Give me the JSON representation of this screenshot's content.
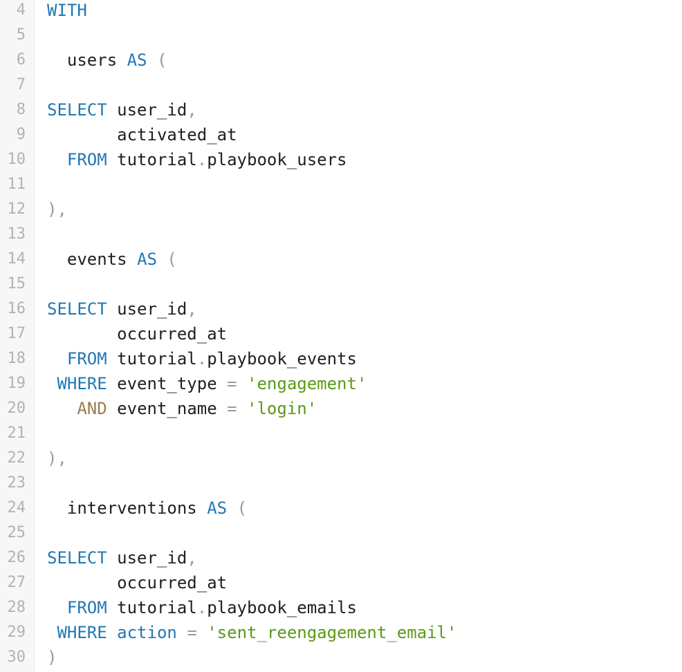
{
  "editor": {
    "lines": [
      {
        "number": "4",
        "tokens": [
          {
            "type": "kw",
            "text": "WITH"
          }
        ]
      },
      {
        "number": "5",
        "tokens": []
      },
      {
        "number": "6",
        "tokens": [
          {
            "type": "ws",
            "text": "  "
          },
          {
            "type": "id",
            "text": "users"
          },
          {
            "type": "ws",
            "text": " "
          },
          {
            "type": "kw",
            "text": "AS"
          },
          {
            "type": "ws",
            "text": " "
          },
          {
            "type": "punct",
            "text": "("
          }
        ]
      },
      {
        "number": "7",
        "tokens": []
      },
      {
        "number": "8",
        "tokens": [
          {
            "type": "kw",
            "text": "SELECT"
          },
          {
            "type": "ws",
            "text": " "
          },
          {
            "type": "id",
            "text": "user_id"
          },
          {
            "type": "punct",
            "text": ","
          }
        ]
      },
      {
        "number": "9",
        "tokens": [
          {
            "type": "ws",
            "text": "       "
          },
          {
            "type": "id",
            "text": "activated_at"
          }
        ]
      },
      {
        "number": "10",
        "tokens": [
          {
            "type": "ws",
            "text": "  "
          },
          {
            "type": "kw",
            "text": "FROM"
          },
          {
            "type": "ws",
            "text": " "
          },
          {
            "type": "id",
            "text": "tutorial"
          },
          {
            "type": "punct",
            "text": "."
          },
          {
            "type": "id",
            "text": "playbook_users"
          }
        ]
      },
      {
        "number": "11",
        "tokens": []
      },
      {
        "number": "12",
        "tokens": [
          {
            "type": "punct",
            "text": "),"
          }
        ]
      },
      {
        "number": "13",
        "tokens": []
      },
      {
        "number": "14",
        "tokens": [
          {
            "type": "ws",
            "text": "  "
          },
          {
            "type": "id",
            "text": "events"
          },
          {
            "type": "ws",
            "text": " "
          },
          {
            "type": "kw",
            "text": "AS"
          },
          {
            "type": "ws",
            "text": " "
          },
          {
            "type": "punct",
            "text": "("
          }
        ]
      },
      {
        "number": "15",
        "tokens": []
      },
      {
        "number": "16",
        "tokens": [
          {
            "type": "kw",
            "text": "SELECT"
          },
          {
            "type": "ws",
            "text": " "
          },
          {
            "type": "id",
            "text": "user_id"
          },
          {
            "type": "punct",
            "text": ","
          }
        ]
      },
      {
        "number": "17",
        "tokens": [
          {
            "type": "ws",
            "text": "       "
          },
          {
            "type": "id",
            "text": "occurred_at"
          }
        ]
      },
      {
        "number": "18",
        "tokens": [
          {
            "type": "ws",
            "text": "  "
          },
          {
            "type": "kw",
            "text": "FROM"
          },
          {
            "type": "ws",
            "text": " "
          },
          {
            "type": "id",
            "text": "tutorial"
          },
          {
            "type": "punct",
            "text": "."
          },
          {
            "type": "id",
            "text": "playbook_events"
          }
        ]
      },
      {
        "number": "19",
        "tokens": [
          {
            "type": "ws",
            "text": " "
          },
          {
            "type": "kw",
            "text": "WHERE"
          },
          {
            "type": "ws",
            "text": " "
          },
          {
            "type": "id",
            "text": "event_type"
          },
          {
            "type": "ws",
            "text": " "
          },
          {
            "type": "op",
            "text": "="
          },
          {
            "type": "ws",
            "text": " "
          },
          {
            "type": "str",
            "text": "'engagement'"
          }
        ]
      },
      {
        "number": "20",
        "tokens": [
          {
            "type": "ws",
            "text": "   "
          },
          {
            "type": "and",
            "text": "AND"
          },
          {
            "type": "ws",
            "text": " "
          },
          {
            "type": "id",
            "text": "event_name"
          },
          {
            "type": "ws",
            "text": " "
          },
          {
            "type": "op",
            "text": "="
          },
          {
            "type": "ws",
            "text": " "
          },
          {
            "type": "str",
            "text": "'login'"
          }
        ]
      },
      {
        "number": "21",
        "tokens": []
      },
      {
        "number": "22",
        "tokens": [
          {
            "type": "punct",
            "text": "),"
          }
        ]
      },
      {
        "number": "23",
        "tokens": []
      },
      {
        "number": "24",
        "tokens": [
          {
            "type": "ws",
            "text": "  "
          },
          {
            "type": "id",
            "text": "interventions"
          },
          {
            "type": "ws",
            "text": " "
          },
          {
            "type": "kw",
            "text": "AS"
          },
          {
            "type": "ws",
            "text": " "
          },
          {
            "type": "punct",
            "text": "("
          }
        ]
      },
      {
        "number": "25",
        "tokens": []
      },
      {
        "number": "26",
        "tokens": [
          {
            "type": "kw",
            "text": "SELECT"
          },
          {
            "type": "ws",
            "text": " "
          },
          {
            "type": "id",
            "text": "user_id"
          },
          {
            "type": "punct",
            "text": ","
          }
        ]
      },
      {
        "number": "27",
        "tokens": [
          {
            "type": "ws",
            "text": "       "
          },
          {
            "type": "id",
            "text": "occurred_at"
          }
        ]
      },
      {
        "number": "28",
        "tokens": [
          {
            "type": "ws",
            "text": "  "
          },
          {
            "type": "kw",
            "text": "FROM"
          },
          {
            "type": "ws",
            "text": " "
          },
          {
            "type": "id",
            "text": "tutorial"
          },
          {
            "type": "punct",
            "text": "."
          },
          {
            "type": "id",
            "text": "playbook_emails"
          }
        ]
      },
      {
        "number": "29",
        "tokens": [
          {
            "type": "ws",
            "text": " "
          },
          {
            "type": "kw",
            "text": "WHERE"
          },
          {
            "type": "ws",
            "text": " "
          },
          {
            "type": "kw",
            "text": "action"
          },
          {
            "type": "ws",
            "text": " "
          },
          {
            "type": "op",
            "text": "="
          },
          {
            "type": "ws",
            "text": " "
          },
          {
            "type": "str",
            "text": "'sent_reengagement_email'"
          }
        ]
      },
      {
        "number": "30",
        "tokens": [
          {
            "type": "punct",
            "text": ")"
          }
        ]
      }
    ]
  },
  "colors": {
    "keyword": "#1f78b4",
    "and_keyword": "#9a7c52",
    "string": "#5a9a14",
    "punctuation": "#9a9a9a",
    "text": "#1f1f1f",
    "gutter_number": "#b2b2b2",
    "gutter_background": "#f7f7f7"
  }
}
